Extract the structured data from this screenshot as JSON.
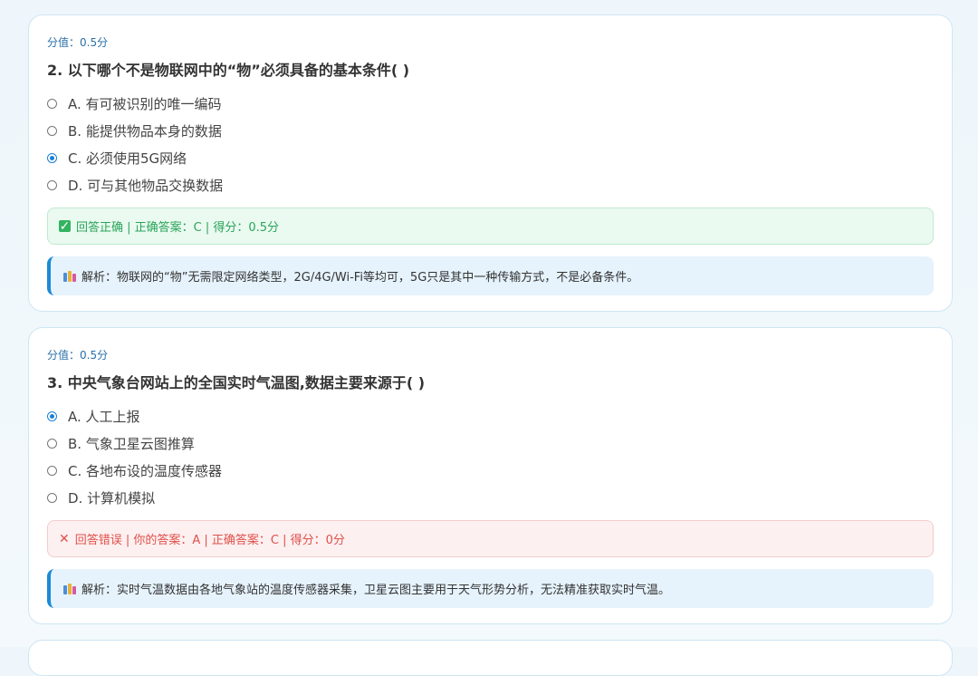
{
  "questions": [
    {
      "score_label": "分值：0.5分",
      "title": "2. 以下哪个不是物联网中的“物”必须具备的基本条件( )",
      "options": [
        {
          "label": "A. 有可被识别的唯一编码",
          "checked": false
        },
        {
          "label": "B. 能提供物品本身的数据",
          "checked": false
        },
        {
          "label": "C. 必须使用5G网络",
          "checked": true
        },
        {
          "label": "D. 可与其他物品交换数据",
          "checked": false
        }
      ],
      "result_status": "correct",
      "result_icon": "check-icon",
      "result_text": "回答正确 | 正确答案：C | 得分：0.5分",
      "explanation": "解析：物联网的“物”无需限定网络类型，2G/4G/Wi-Fi等均可，5G只是其中一种传输方式，不是必备条件。"
    },
    {
      "score_label": "分值：0.5分",
      "title": "3. 中央气象台网站上的全国实时气温图,数据主要来源于( )",
      "options": [
        {
          "label": "A. 人工上报",
          "checked": true
        },
        {
          "label": "B. 气象卫星云图推算",
          "checked": false
        },
        {
          "label": "C. 各地布设的温度传感器",
          "checked": false
        },
        {
          "label": "D. 计算机模拟",
          "checked": false
        }
      ],
      "result_status": "wrong",
      "result_icon": "cross-icon",
      "result_text": "回答错误 | 你的答案：A | 正确答案：C | 得分：0分",
      "explanation": "解析：实时气温数据由各地气象站的温度传感器采集，卫星云图主要用于天气形势分析，无法精准获取实时气温。"
    }
  ],
  "colors": {
    "correct": "#2aa45a",
    "wrong": "#e0504a",
    "accent": "#1b7fd6"
  }
}
